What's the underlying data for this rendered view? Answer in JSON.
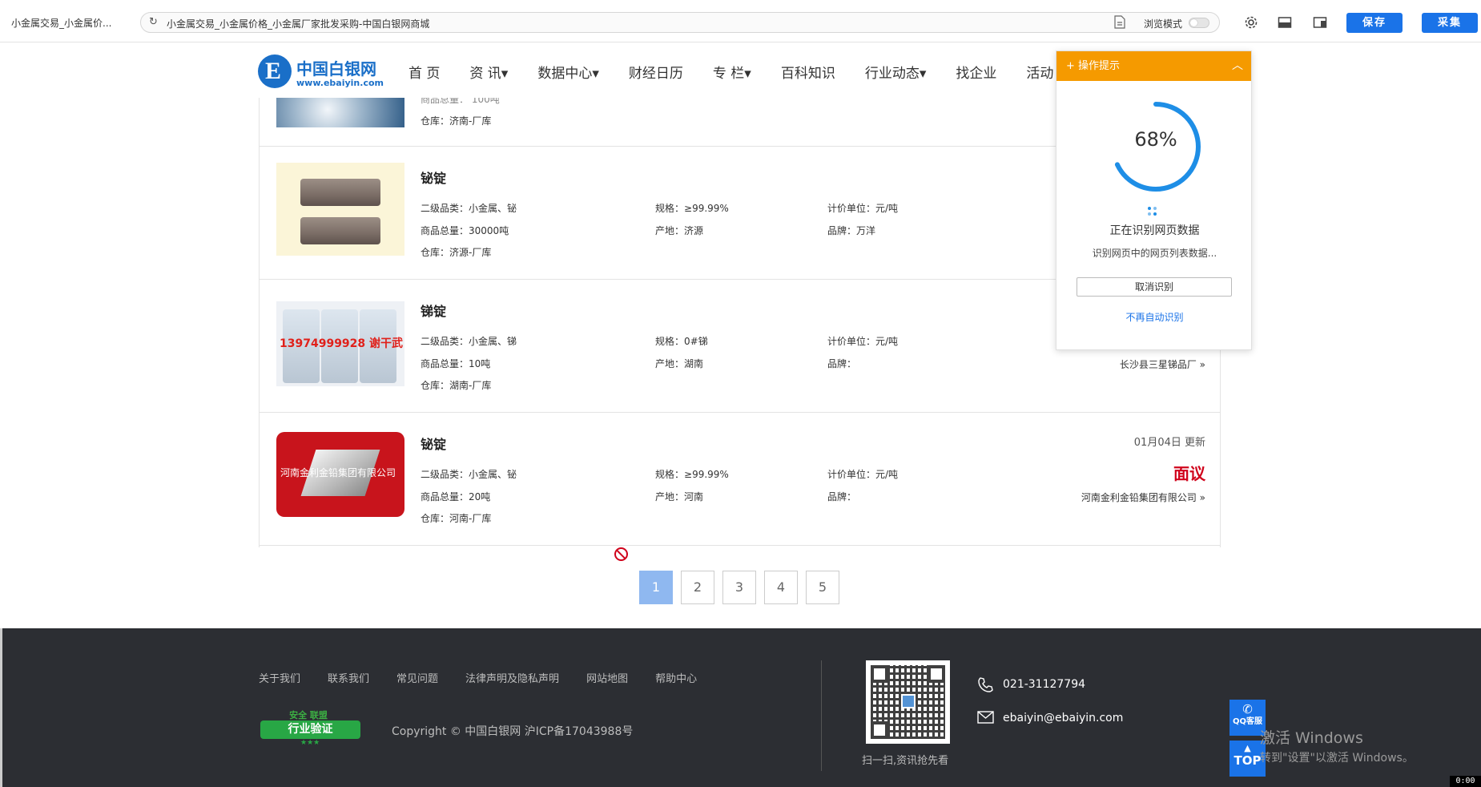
{
  "browser": {
    "tab_title": "小金属交易_小金属价...",
    "url": "小金属交易_小金属价格_小金属厂家批发采购-中国白银网商城",
    "mode_label": "浏览模式",
    "save_label": "保存",
    "collect_label": "采集"
  },
  "site": {
    "logo_cn": "中国白银网",
    "logo_en": "www.ebaiyin.com",
    "nav": [
      "首 页",
      "资 讯▾",
      "数据中心▾",
      "财经日历",
      "专 栏▾",
      "百科知识",
      "行业动态▾",
      "找企业",
      "活动"
    ]
  },
  "products": [
    {
      "name": "",
      "warehouse_label": "仓库：",
      "warehouse": "济南-厂库",
      "partial_top_text": "商品总量：  100吨",
      "thumb": "white-powder"
    },
    {
      "name": "铋锭",
      "cat_label": "二级品类：",
      "cat": "小金属、铋",
      "spec_label": "规格：",
      "spec": "≥99.99%",
      "unit_label": "计价单位：",
      "unit": "元/吨",
      "qty_label": "商品总量：",
      "qty": "30000吨",
      "origin_label": "产地：",
      "origin": "济源",
      "brand_label": "品牌：",
      "brand": "万洋",
      "warehouse_label": "仓库：",
      "warehouse": "济源-厂库",
      "thumb": "bismuth-bars"
    },
    {
      "name": "锑锭",
      "cat_label": "二级品类：",
      "cat": "小金属、锑",
      "spec_label": "规格：",
      "spec": "0#锑",
      "unit_label": "计价单位：",
      "unit": "元/吨",
      "qty_label": "商品总量：",
      "qty": "10吨",
      "origin_label": "产地：",
      "origin": "湖南",
      "brand_label": "品牌：",
      "brand": "",
      "warehouse_label": "仓库：",
      "warehouse": "湖南-厂库",
      "company": "长沙县三星锑品厂",
      "thumb_watermark": "13974999928  谢干武",
      "thumb": "antimony-bags"
    },
    {
      "name": "铋锭",
      "date": "01月04日 更新",
      "price": "面议",
      "cat_label": "二级品类：",
      "cat": "小金属、铋",
      "spec_label": "规格：",
      "spec": "≥99.99%",
      "unit_label": "计价单位：",
      "unit": "元/吨",
      "qty_label": "商品总量：",
      "qty": "20吨",
      "origin_label": "产地：",
      "origin": "河南",
      "brand_label": "品牌：",
      "brand": "",
      "warehouse_label": "仓库：",
      "warehouse": "河南-厂库",
      "company": "河南金利金铅集团有限公司",
      "thumb_watermark": "河南金利金铅集团有限公司",
      "thumb": "bismuth-red"
    }
  ],
  "pagination": {
    "pages": [
      "1",
      "2",
      "3",
      "4",
      "5"
    ],
    "active": 1
  },
  "footer": {
    "links": [
      "关于我们",
      "联系我们",
      "常见问题",
      "法律声明及隐私声明",
      "网站地图",
      "帮助中心"
    ],
    "badge_top": "安全 联盟",
    "badge_main": "行业验证",
    "copyright": "Copyright © 中国白银网 沪ICP备17043988号",
    "qr_caption": "扫一扫,资讯抢先看",
    "phone": "021-31127794",
    "email": "ebaiyin@ebaiyin.com",
    "qq_label": "QQ客服",
    "top_label": "TOP"
  },
  "windows_watermark": {
    "line1": "激活 Windows",
    "line2": "转到\"设置\"以激活 Windows。"
  },
  "clock": "0:00",
  "panel": {
    "title": "操作提示",
    "progress_percent": 68,
    "progress_text": "68%",
    "status": "正在识别网页数据",
    "sub": "识别网页中的网页列表数据...",
    "cancel_label": "取消识别",
    "no_auto_label": "不再自动识别"
  },
  "colors": {
    "accent_blue": "#1a73e8",
    "panel_orange": "#f59a00",
    "price_red": "#d0021b",
    "footer_bg": "#2c2e33"
  }
}
